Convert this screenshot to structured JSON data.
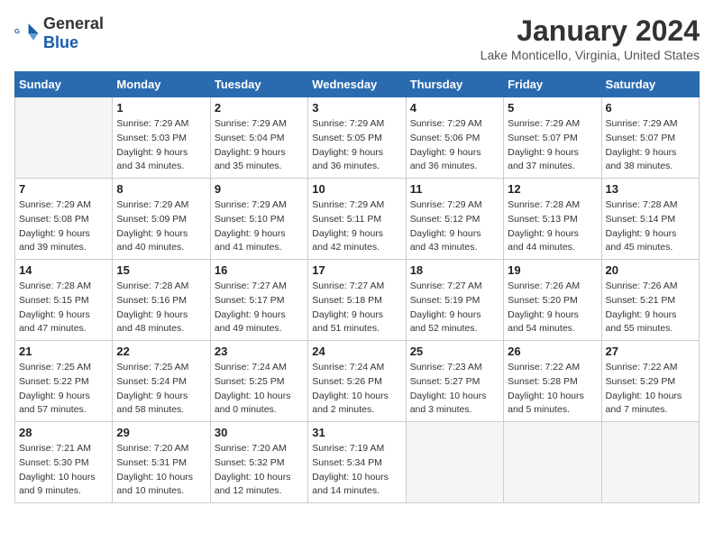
{
  "header": {
    "logo_general": "General",
    "logo_blue": "Blue",
    "title": "January 2024",
    "subtitle": "Lake Monticello, Virginia, United States"
  },
  "columns": [
    "Sunday",
    "Monday",
    "Tuesday",
    "Wednesday",
    "Thursday",
    "Friday",
    "Saturday"
  ],
  "weeks": [
    [
      {
        "day": "",
        "info": ""
      },
      {
        "day": "1",
        "info": "Sunrise: 7:29 AM\nSunset: 5:03 PM\nDaylight: 9 hours\nand 34 minutes."
      },
      {
        "day": "2",
        "info": "Sunrise: 7:29 AM\nSunset: 5:04 PM\nDaylight: 9 hours\nand 35 minutes."
      },
      {
        "day": "3",
        "info": "Sunrise: 7:29 AM\nSunset: 5:05 PM\nDaylight: 9 hours\nand 36 minutes."
      },
      {
        "day": "4",
        "info": "Sunrise: 7:29 AM\nSunset: 5:06 PM\nDaylight: 9 hours\nand 36 minutes."
      },
      {
        "day": "5",
        "info": "Sunrise: 7:29 AM\nSunset: 5:07 PM\nDaylight: 9 hours\nand 37 minutes."
      },
      {
        "day": "6",
        "info": "Sunrise: 7:29 AM\nSunset: 5:07 PM\nDaylight: 9 hours\nand 38 minutes."
      }
    ],
    [
      {
        "day": "7",
        "info": "Sunrise: 7:29 AM\nSunset: 5:08 PM\nDaylight: 9 hours\nand 39 minutes."
      },
      {
        "day": "8",
        "info": "Sunrise: 7:29 AM\nSunset: 5:09 PM\nDaylight: 9 hours\nand 40 minutes."
      },
      {
        "day": "9",
        "info": "Sunrise: 7:29 AM\nSunset: 5:10 PM\nDaylight: 9 hours\nand 41 minutes."
      },
      {
        "day": "10",
        "info": "Sunrise: 7:29 AM\nSunset: 5:11 PM\nDaylight: 9 hours\nand 42 minutes."
      },
      {
        "day": "11",
        "info": "Sunrise: 7:29 AM\nSunset: 5:12 PM\nDaylight: 9 hours\nand 43 minutes."
      },
      {
        "day": "12",
        "info": "Sunrise: 7:28 AM\nSunset: 5:13 PM\nDaylight: 9 hours\nand 44 minutes."
      },
      {
        "day": "13",
        "info": "Sunrise: 7:28 AM\nSunset: 5:14 PM\nDaylight: 9 hours\nand 45 minutes."
      }
    ],
    [
      {
        "day": "14",
        "info": "Sunrise: 7:28 AM\nSunset: 5:15 PM\nDaylight: 9 hours\nand 47 minutes."
      },
      {
        "day": "15",
        "info": "Sunrise: 7:28 AM\nSunset: 5:16 PM\nDaylight: 9 hours\nand 48 minutes."
      },
      {
        "day": "16",
        "info": "Sunrise: 7:27 AM\nSunset: 5:17 PM\nDaylight: 9 hours\nand 49 minutes."
      },
      {
        "day": "17",
        "info": "Sunrise: 7:27 AM\nSunset: 5:18 PM\nDaylight: 9 hours\nand 51 minutes."
      },
      {
        "day": "18",
        "info": "Sunrise: 7:27 AM\nSunset: 5:19 PM\nDaylight: 9 hours\nand 52 minutes."
      },
      {
        "day": "19",
        "info": "Sunrise: 7:26 AM\nSunset: 5:20 PM\nDaylight: 9 hours\nand 54 minutes."
      },
      {
        "day": "20",
        "info": "Sunrise: 7:26 AM\nSunset: 5:21 PM\nDaylight: 9 hours\nand 55 minutes."
      }
    ],
    [
      {
        "day": "21",
        "info": "Sunrise: 7:25 AM\nSunset: 5:22 PM\nDaylight: 9 hours\nand 57 minutes."
      },
      {
        "day": "22",
        "info": "Sunrise: 7:25 AM\nSunset: 5:24 PM\nDaylight: 9 hours\nand 58 minutes."
      },
      {
        "day": "23",
        "info": "Sunrise: 7:24 AM\nSunset: 5:25 PM\nDaylight: 10 hours\nand 0 minutes."
      },
      {
        "day": "24",
        "info": "Sunrise: 7:24 AM\nSunset: 5:26 PM\nDaylight: 10 hours\nand 2 minutes."
      },
      {
        "day": "25",
        "info": "Sunrise: 7:23 AM\nSunset: 5:27 PM\nDaylight: 10 hours\nand 3 minutes."
      },
      {
        "day": "26",
        "info": "Sunrise: 7:22 AM\nSunset: 5:28 PM\nDaylight: 10 hours\nand 5 minutes."
      },
      {
        "day": "27",
        "info": "Sunrise: 7:22 AM\nSunset: 5:29 PM\nDaylight: 10 hours\nand 7 minutes."
      }
    ],
    [
      {
        "day": "28",
        "info": "Sunrise: 7:21 AM\nSunset: 5:30 PM\nDaylight: 10 hours\nand 9 minutes."
      },
      {
        "day": "29",
        "info": "Sunrise: 7:20 AM\nSunset: 5:31 PM\nDaylight: 10 hours\nand 10 minutes."
      },
      {
        "day": "30",
        "info": "Sunrise: 7:20 AM\nSunset: 5:32 PM\nDaylight: 10 hours\nand 12 minutes."
      },
      {
        "day": "31",
        "info": "Sunrise: 7:19 AM\nSunset: 5:34 PM\nDaylight: 10 hours\nand 14 minutes."
      },
      {
        "day": "",
        "info": ""
      },
      {
        "day": "",
        "info": ""
      },
      {
        "day": "",
        "info": ""
      }
    ]
  ]
}
